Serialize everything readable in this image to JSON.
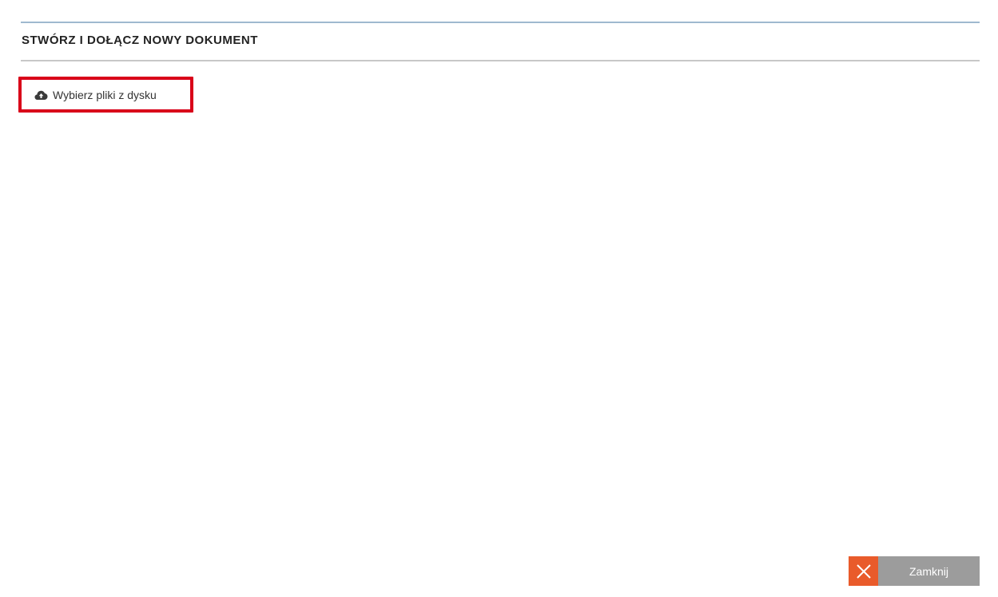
{
  "dialog": {
    "title": "STWÓRZ I DOŁĄCZ NOWY DOKUMENT"
  },
  "upload": {
    "label": "Wybierz pliki z dysku",
    "icon": "cloud-upload-icon",
    "highlight_color": "#d90019"
  },
  "footer": {
    "close_label": "Zamknij",
    "close_icon": "close-icon",
    "close_icon_bg": "#e95b2b",
    "close_label_bg": "#9c9c9c"
  }
}
